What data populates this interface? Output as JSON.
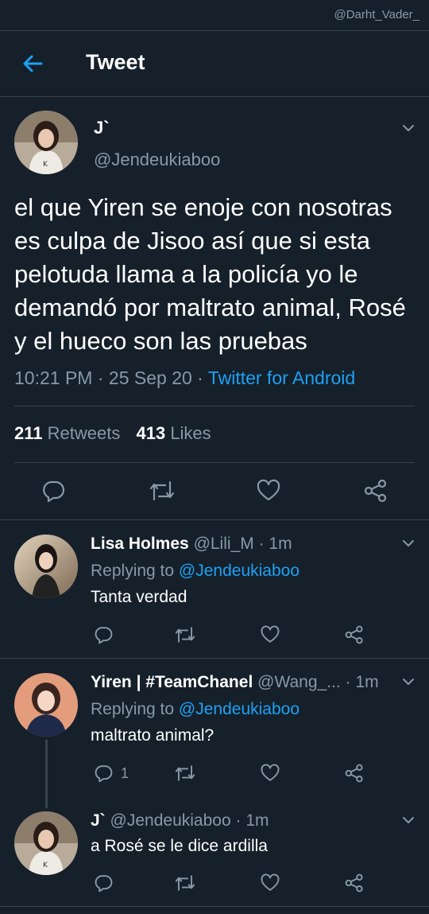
{
  "watermark": "@Darht_Vader_",
  "header": {
    "title": "Tweet"
  },
  "tweet": {
    "name": "J`",
    "handle": "@Jendeukiaboo",
    "text": "el que Yiren se enoje con nosotras es culpa de Jisoo así que si esta pelotuda llama a la policía yo le demandó por maltrato animal, Rosé y el hueco son las pruebas",
    "time": "10:21 PM",
    "date": "25 Sep 20",
    "client": "Twitter for Android",
    "retweets_count": "211",
    "retweets_label": "Retweets",
    "likes_count": "413",
    "likes_label": "Likes"
  },
  "replies": [
    {
      "name": "Lisa Holmes",
      "handle": "@Lili_M",
      "age": "1m",
      "replying_label": "Replying to",
      "replying_to": "@Jendeukiaboo",
      "text": "Tanta verdad",
      "reply_count": ""
    },
    {
      "name": "Yiren | #TeamChanel",
      "handle": "@Wang_...",
      "age": "1m",
      "replying_label": "Replying to",
      "replying_to": "@Jendeukiaboo",
      "text": "maltrato animal?",
      "reply_count": "1"
    },
    {
      "name": "J`",
      "handle": "@Jendeukiaboo",
      "age": "1m",
      "text": "a Rosé se le dice ardilla",
      "reply_count": ""
    }
  ],
  "colors": {
    "background": "#15202b",
    "divider": "#38444d",
    "muted": "#8899a6",
    "accent": "#1da1f2"
  },
  "icons": [
    "back-arrow-icon",
    "chevron-down-icon",
    "reply-icon",
    "retweet-icon",
    "like-icon",
    "share-icon"
  ]
}
